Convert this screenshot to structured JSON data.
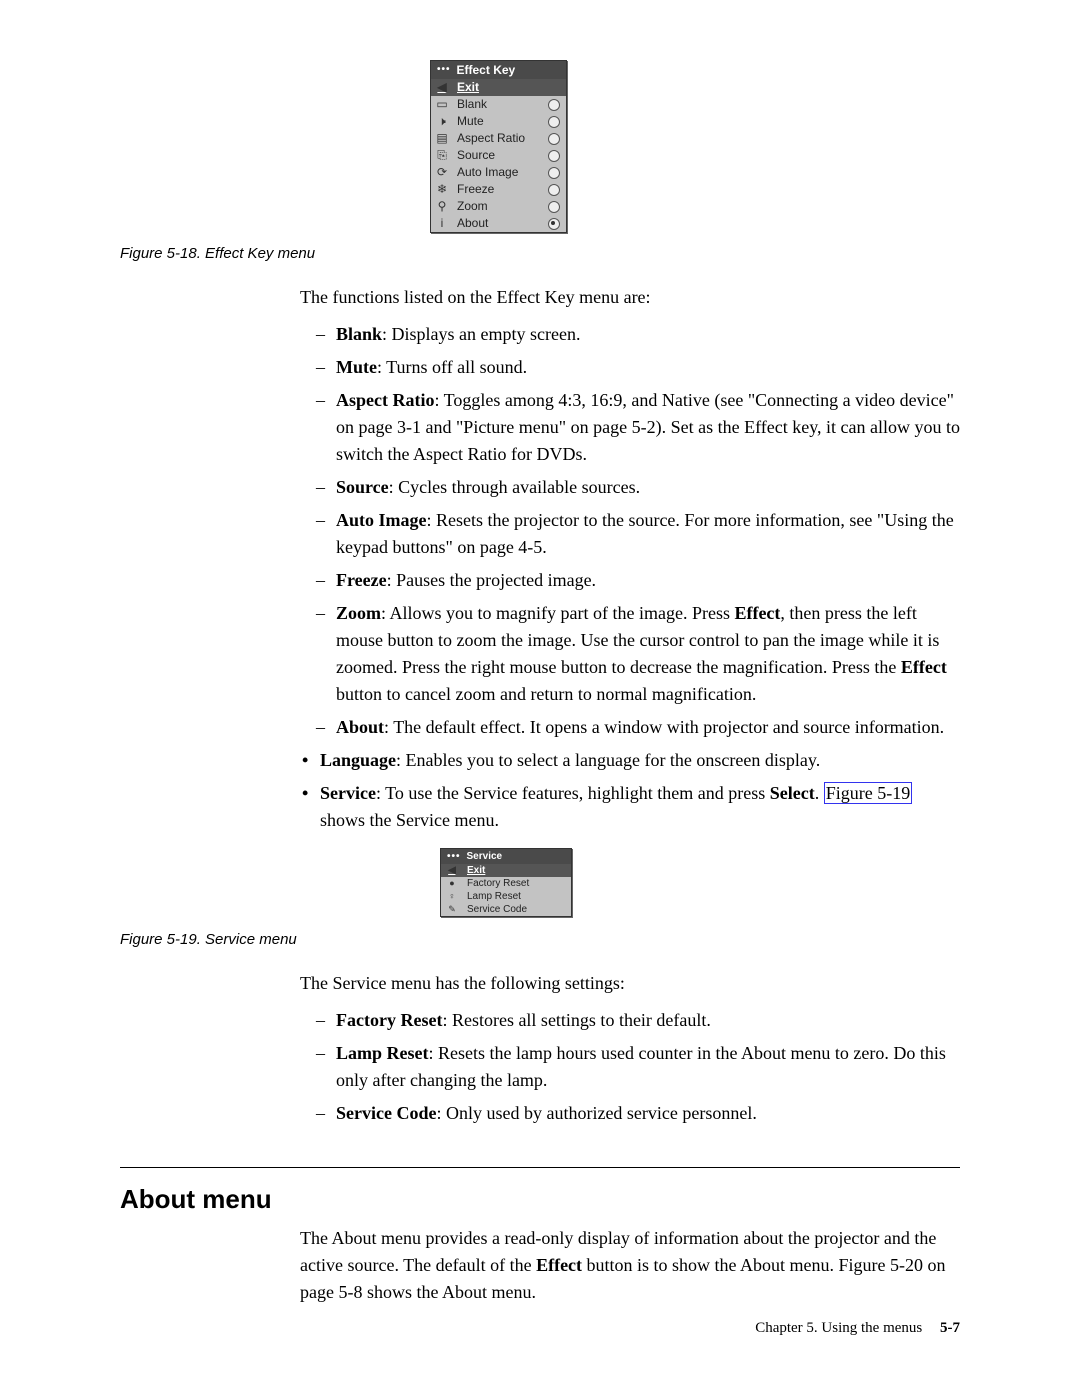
{
  "effect_menu": {
    "title": "Effect Key",
    "exit": "Exit",
    "items": [
      {
        "label": "Blank"
      },
      {
        "label": "Mute"
      },
      {
        "label": "Aspect Ratio"
      },
      {
        "label": "Source"
      },
      {
        "label": "Auto Image"
      },
      {
        "label": "Freeze"
      },
      {
        "label": "Zoom"
      },
      {
        "label": "About"
      }
    ]
  },
  "fig18_caption": "Figure 5-18. Effect Key menu",
  "intro1": "The functions listed on the Effect Key menu are:",
  "items": {
    "blank_b": "Blank",
    "blank_t": ": Displays an empty screen.",
    "mute_b": "Mute",
    "mute_t": ": Turns off all sound.",
    "ar_b": "Aspect Ratio",
    "ar_t": ": Toggles among 4:3, 16:9, and Native (see \"Connecting a video device\" on page 3-1 and \"Picture menu\" on page 5-2). Set as the Effect key, it can allow you to switch the Aspect Ratio for DVDs.",
    "src_b": "Source",
    "src_t": ": Cycles through available sources.",
    "ai_b": "Auto Image",
    "ai_t": ": Resets the projector to the source. For more information, see \"Using the keypad buttons\" on page 4-5.",
    "fr_b": "Freeze",
    "fr_t": ": Pauses the projected image.",
    "zoom_b": "Zoom",
    "zoom_t1": ": Allows you to magnify part of the image. Press ",
    "zoom_eff": "Effect",
    "zoom_t2": ", then press the left mouse button to zoom the image. Use the cursor control to pan the image while it is zoomed. Press the right mouse button to decrease the magnification. Press the ",
    "zoom_eff2": "Effect",
    "zoom_t3": " button to cancel zoom and return to normal magnification.",
    "about_b": "About",
    "about_t": ": The default effect. It opens a window with projector and source information."
  },
  "bullets": {
    "lang_b": "Language",
    "lang_t": ": Enables you to select a language for the onscreen display.",
    "svc_b": "Service",
    "svc_t1": ": To use the Service features, highlight them and press ",
    "svc_sel": "Select",
    "svc_t2": ". ",
    "svc_link": "Figure 5-19",
    "svc_t3": " shows the Service menu."
  },
  "service_menu": {
    "title": "Service",
    "exit": "Exit",
    "items": [
      {
        "label": "Factory Reset"
      },
      {
        "label": "Lamp Reset"
      },
      {
        "label": "Service Code"
      }
    ]
  },
  "fig19_caption": "Figure 5-19. Service menu",
  "intro2": "The Service menu has the following settings:",
  "svc_items": {
    "fr_b": "Factory Reset",
    "fr_t": ": Restores all settings to their default.",
    "lr_b": "Lamp Reset",
    "lr_t": ": Resets the lamp hours used counter in the About menu to zero. Do this only after changing the lamp.",
    "sc_b": "Service Code",
    "sc_t": ": Only used by authorized service personnel."
  },
  "about_heading": "About menu",
  "about_para_1": "The About menu provides a read-only display of information about the projector and the active source. The default of the ",
  "about_para_b": "Effect",
  "about_para_2": " button is to show the About menu. Figure 5-20 on page 5-8 shows the About menu.",
  "footer_chapter": "Chapter 5. Using the menus",
  "footer_page": "5-7"
}
